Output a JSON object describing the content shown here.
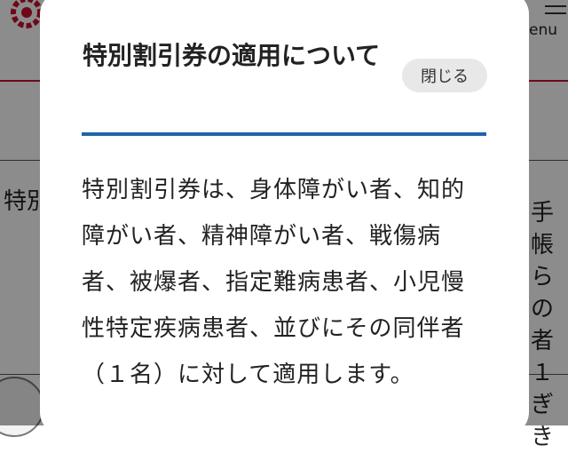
{
  "background": {
    "menu_label": "enu",
    "left_box_text": "特別",
    "right_box_text": "手帳らの者１ぎき"
  },
  "modal": {
    "title": "特別割引券の適用について",
    "close_label": "閉じる",
    "body": "特別割引券は、身体障がい者、知的障がい者、精神障がい者、戦傷病者、被爆者、指定難病患者、小児慢性特定疾病患者、並びにその同伴者（１名）に対して適用します。"
  },
  "colors": {
    "accent_rule": "#1f66aa",
    "brand_red": "#c8102e",
    "close_button_bg": "#e8e8e8"
  }
}
